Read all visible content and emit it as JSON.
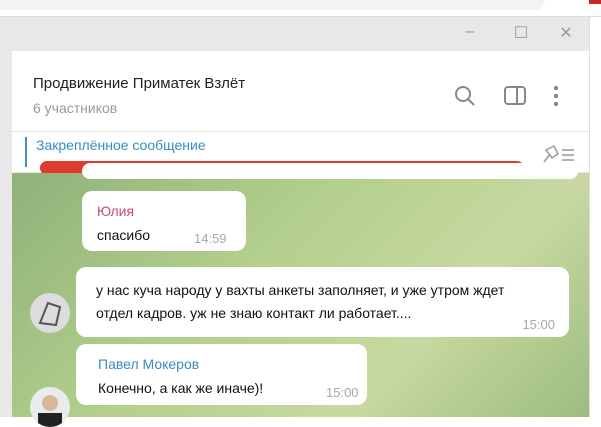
{
  "window": {
    "minimize": "‒",
    "maximize": "☐",
    "close": "✕"
  },
  "header": {
    "title": "Продвижение Приматек Взлёт",
    "subtitle": "6 участников"
  },
  "pinned": {
    "label": "Закреплённое сообщение"
  },
  "messages": [
    {
      "sender": "Юлия",
      "text": "спасибо",
      "time": "14:59"
    },
    {
      "text": "у нас куча народу у вахты анкеты заполняет, и уже утром ждет отдел кадров. уж не знаю контакт ли работает....",
      "time": "15:00"
    },
    {
      "sender": "Павел Мокеров",
      "text": "Конечно, а как же иначе)!",
      "time": "15:00"
    }
  ],
  "colors": {
    "accent": "#3a8cc1",
    "julia": "#c24b7a",
    "redaction": "#e03a2f"
  }
}
